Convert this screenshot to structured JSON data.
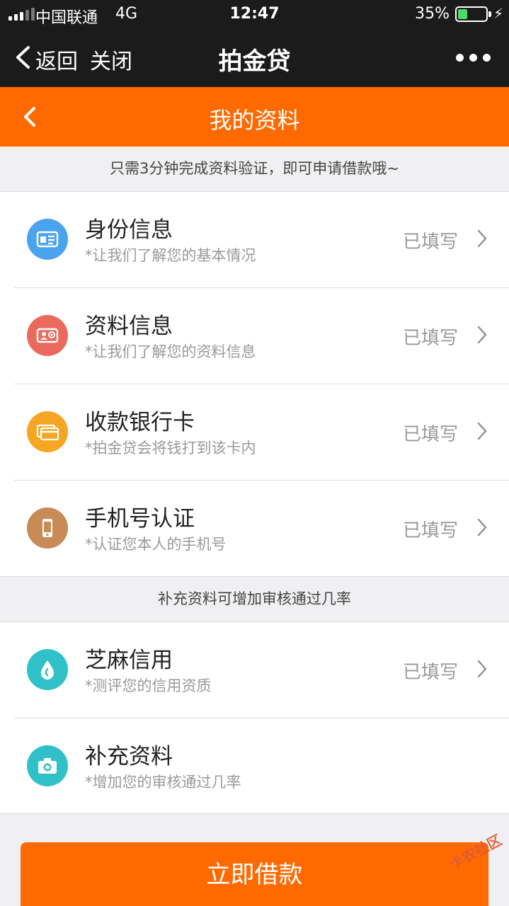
{
  "status_bar": {
    "carrier": "中国联通",
    "network": "4G",
    "time": "12:47",
    "battery_percent": "35%",
    "battery_level": 0.35
  },
  "top_nav": {
    "back_label": "返回",
    "close_label": "关闭",
    "title": "拍金贷"
  },
  "page_header": {
    "title": "我的资料"
  },
  "notice_primary": "只需3分钟完成资料验证，即可申请借款哦~",
  "required_items": [
    {
      "label": "身份信息",
      "subtitle": "*让我们了解您的基本情况",
      "status": "已填写",
      "icon": "id-card-icon",
      "color": "#4aa3ef"
    },
    {
      "label": "资料信息",
      "subtitle": "*让我们了解您的资料信息",
      "status": "已填写",
      "icon": "contact-card-icon",
      "color": "#ea6a5e"
    },
    {
      "label": "收款银行卡",
      "subtitle": "*拍金贷会将钱打到该卡内",
      "status": "已填写",
      "icon": "bank-card-icon",
      "color": "#f5a623"
    },
    {
      "label": "手机号认证",
      "subtitle": "*认证您本人的手机号",
      "status": "已填写",
      "icon": "phone-icon",
      "color": "#c98b55"
    }
  ],
  "notice_secondary": "补充资料可增加审核通过几率",
  "optional_items": [
    {
      "label": "芝麻信用",
      "subtitle": "*测评您的信用资质",
      "status": "已填写",
      "icon": "sesame-icon",
      "color": "#2fc1c7"
    },
    {
      "label": "补充资料",
      "subtitle": "*增加您的审核通过几率",
      "status": "",
      "icon": "camera-icon",
      "color": "#2fc1c7"
    }
  ],
  "cta_label": "立即借款",
  "watermark_text": "卡农社区",
  "colors": {
    "brand_orange": "#ff6a00",
    "nav_dark": "#1b1b1b",
    "background": "#f0f0f2"
  }
}
